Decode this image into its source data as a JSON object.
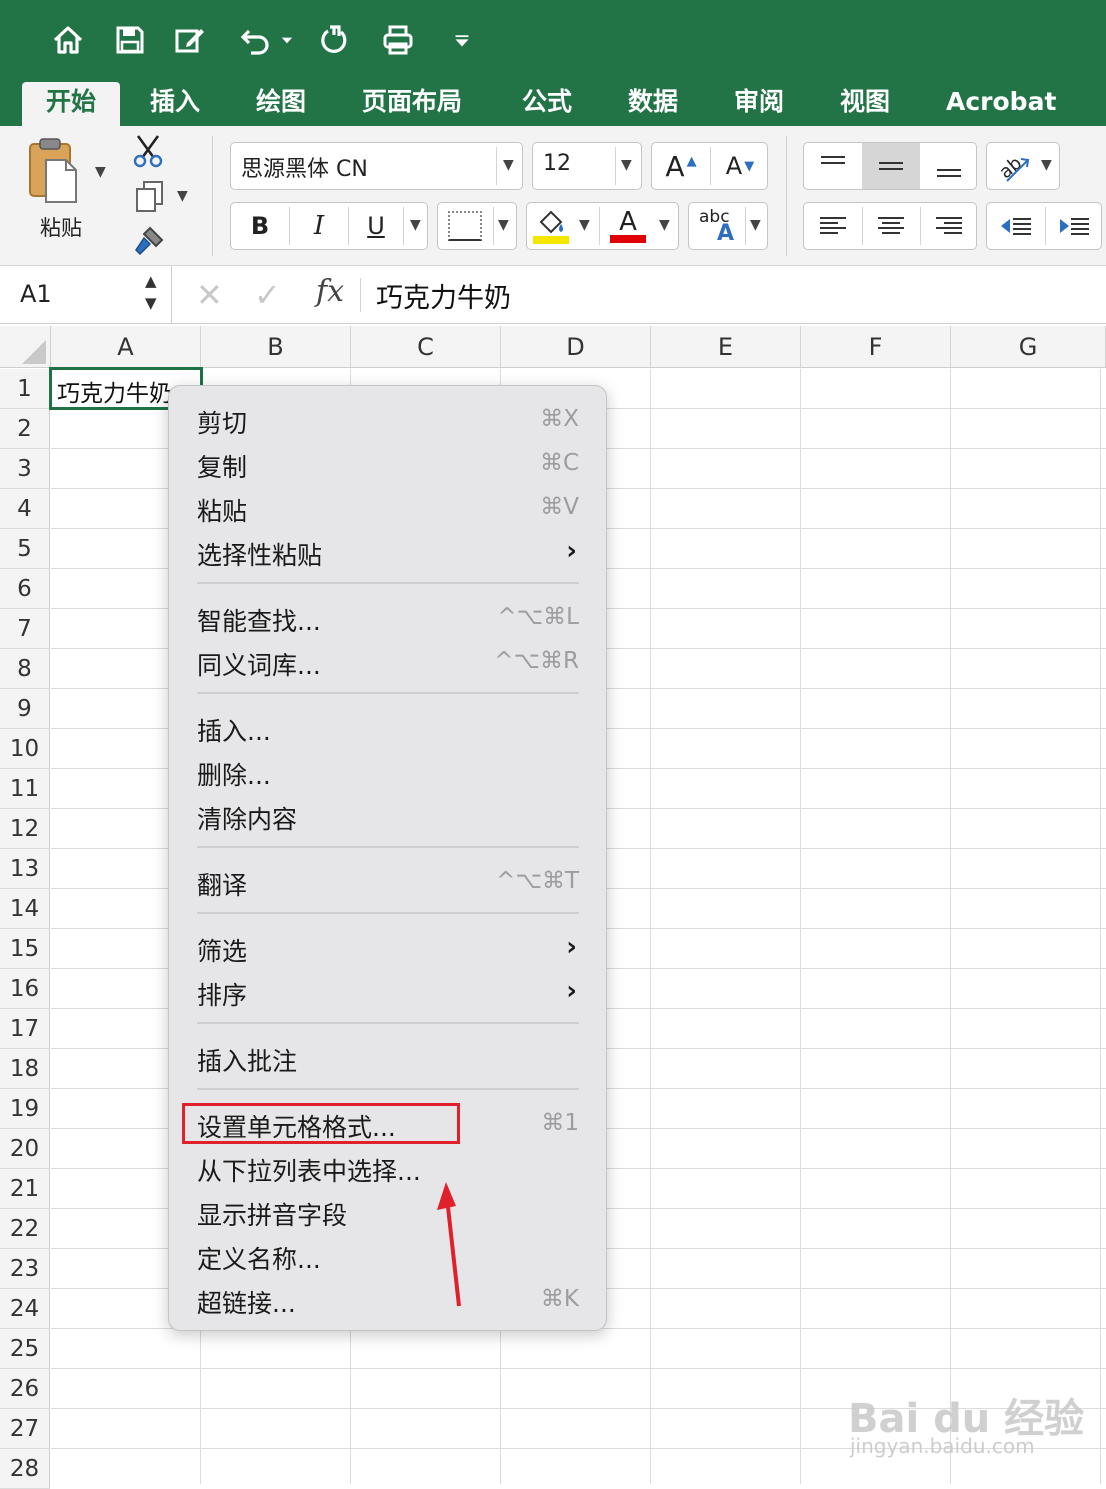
{
  "qat": {
    "icons": [
      "home-icon",
      "save-icon",
      "edit-icon",
      "undo-icon",
      "redo-icon",
      "print-icon",
      "customize-icon"
    ]
  },
  "tabs": [
    {
      "label": "开始",
      "active": true
    },
    {
      "label": "插入"
    },
    {
      "label": "绘图"
    },
    {
      "label": "页面布局"
    },
    {
      "label": "公式"
    },
    {
      "label": "数据"
    },
    {
      "label": "审阅"
    },
    {
      "label": "视图"
    },
    {
      "label": "Acrobat"
    }
  ],
  "ribbon": {
    "paste_label": "粘贴",
    "font_name": "思源黑体 CN",
    "font_size": "12",
    "grow_font": "A",
    "shrink_font": "A",
    "bold": "B",
    "italic": "I",
    "underline": "U",
    "font_color_letter": "A",
    "abc_text": "abc",
    "abc_letter": "A",
    "fill_color": "#f5e600",
    "font_color": "#e00000"
  },
  "formula_bar": {
    "name_box": "A1",
    "fx": "fx",
    "content": "巧克力牛奶"
  },
  "grid": {
    "columns": [
      "A",
      "B",
      "C",
      "D",
      "E",
      "F",
      "G"
    ],
    "rows": [
      "1",
      "2",
      "3",
      "4",
      "5",
      "6",
      "7",
      "8",
      "9",
      "10",
      "11",
      "12",
      "13",
      "14",
      "15",
      "16",
      "17",
      "18",
      "19",
      "20",
      "21",
      "22",
      "23",
      "24",
      "25",
      "26",
      "27",
      "28"
    ],
    "a1_value": "巧克力牛奶"
  },
  "context_menu": {
    "items": [
      {
        "label": "剪切",
        "shortcut": "⌘X"
      },
      {
        "label": "复制",
        "shortcut": "⌘C"
      },
      {
        "label": "粘贴",
        "shortcut": "⌘V"
      },
      {
        "label": "选择性粘贴",
        "submenu": "›"
      },
      {
        "label": "智能查找...",
        "shortcut": "^⌥⌘L"
      },
      {
        "label": "同义词库...",
        "shortcut": "^⌥⌘R"
      },
      {
        "label": "插入..."
      },
      {
        "label": "删除..."
      },
      {
        "label": "清除内容"
      },
      {
        "label": "翻译",
        "shortcut": "^⌥⌘T"
      },
      {
        "label": "筛选",
        "submenu": "›"
      },
      {
        "label": "排序",
        "submenu": "›"
      },
      {
        "label": "插入批注"
      },
      {
        "label": "设置单元格格式...",
        "shortcut": "⌘1",
        "highlighted": true
      },
      {
        "label": "从下拉列表中选择..."
      },
      {
        "label": "显示拼音字段"
      },
      {
        "label": "定义名称..."
      },
      {
        "label": "超链接...",
        "shortcut": "⌘K"
      }
    ]
  },
  "annotation": {
    "highlight_color": "#e0202a"
  },
  "watermark": {
    "brand": "Bai du 经验",
    "url": "jingyan.baidu.com"
  }
}
